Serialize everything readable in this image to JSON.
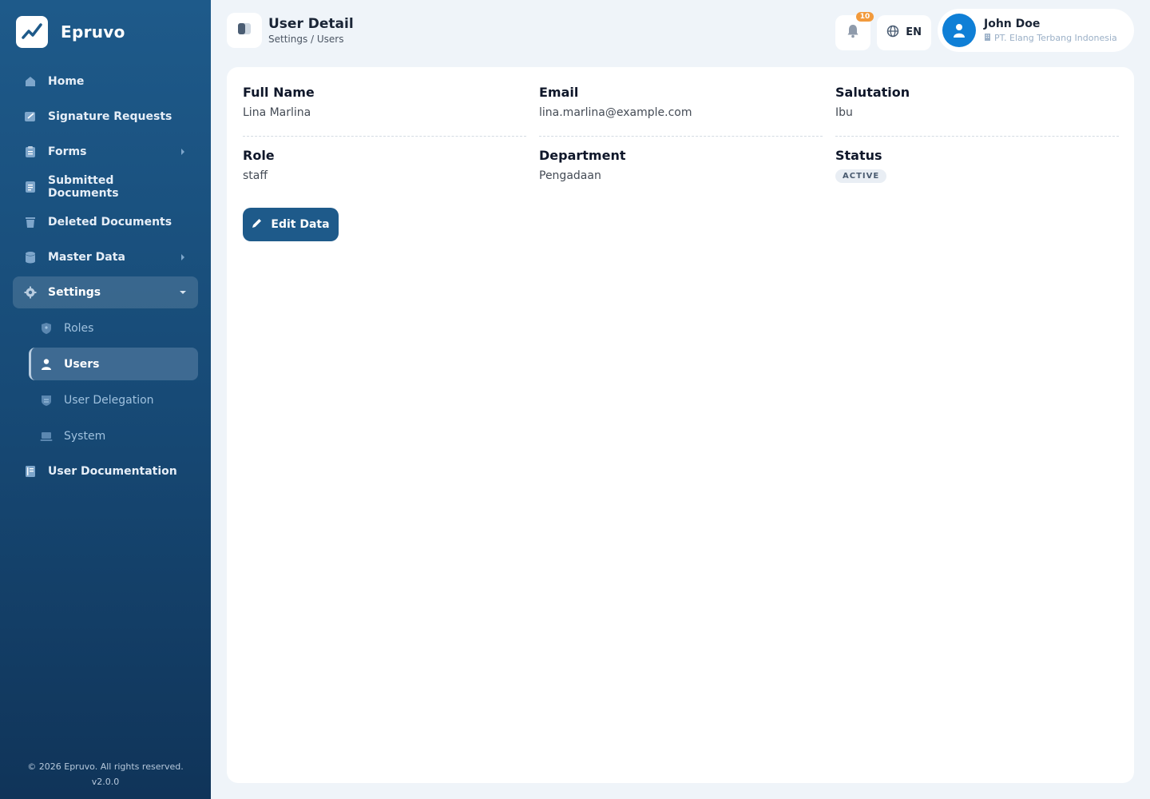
{
  "app": {
    "name": "Epruvo"
  },
  "sidebar": {
    "items": [
      {
        "label": "Home",
        "icon": "home-icon"
      },
      {
        "label": "Signature Requests",
        "icon": "signature-icon"
      },
      {
        "label": "Forms",
        "icon": "clipboard-icon"
      },
      {
        "label": "Submitted Documents",
        "icon": "document-icon"
      },
      {
        "label": "Deleted Documents",
        "icon": "trash-icon"
      },
      {
        "label": "Master Data",
        "icon": "database-icon"
      },
      {
        "label": "Settings",
        "icon": "gear-icon"
      }
    ],
    "settings_sub": [
      {
        "label": "Roles",
        "icon": "shield-icon"
      },
      {
        "label": "Users",
        "icon": "user-icon"
      },
      {
        "label": "User Delegation",
        "icon": "delegation-icon"
      },
      {
        "label": "System",
        "icon": "laptop-icon"
      }
    ],
    "docs": {
      "label": "User Documentation",
      "icon": "book-icon"
    },
    "footer": {
      "copyright": "© 2026 Epruvo. All rights reserved.",
      "version": "v2.0.0"
    }
  },
  "header": {
    "title": "User Detail",
    "breadcrumb": "Settings / Users",
    "notification_count": "10",
    "language": "EN",
    "user": {
      "name": "John Doe",
      "organization": "PT. Elang Terbang Indonesia"
    }
  },
  "detail": {
    "full_name": {
      "label": "Full Name",
      "value": "Lina Marlina"
    },
    "email": {
      "label": "Email",
      "value": "lina.marlina@example.com"
    },
    "salutation": {
      "label": "Salutation",
      "value": "Ibu"
    },
    "role": {
      "label": "Role",
      "value": "staff"
    },
    "department": {
      "label": "Department",
      "value": "Pengadaan"
    },
    "status": {
      "label": "Status",
      "value": "ACTIVE"
    },
    "edit_label": "Edit Data"
  },
  "colors": {
    "primary": "#1e5a8a",
    "accent": "#0f7fd6",
    "badge": "#f29a3c"
  }
}
